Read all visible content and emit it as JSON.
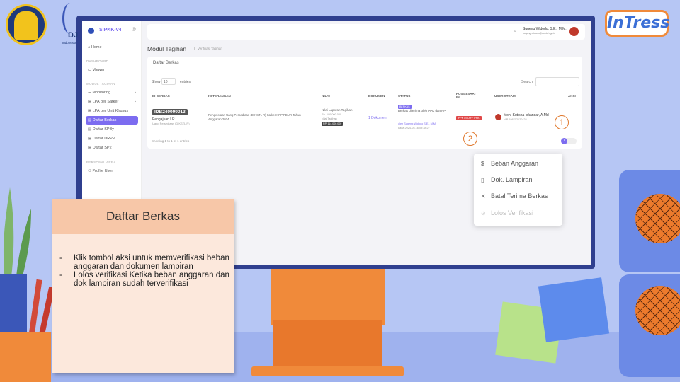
{
  "app": {
    "name": "SIPKK-v4"
  },
  "header": {
    "user_name": "Sugeng Widodo, S.E., M.M.",
    "user_email": "sugeng.widodo@contoh.go.id"
  },
  "sidebar": {
    "home": "Home",
    "section_dashboard": "DASHBOARD",
    "viewer": "Viewer",
    "section_modul": "MODUL TAGIHAN",
    "items": [
      {
        "label": "Monitoring"
      },
      {
        "label": "LPA per Satker"
      },
      {
        "label": "LPA per Unit Khusus"
      },
      {
        "label": "Daftar Berkas"
      },
      {
        "label": "Daftar SPBy"
      },
      {
        "label": "Daftar DRPP"
      },
      {
        "label": "Daftar SP2"
      }
    ],
    "section_personal": "PERSONAL AREA",
    "profile": "Profile User"
  },
  "page": {
    "title": "Modul Tagihan",
    "breadcrumb": "Verifikasi Tagihan"
  },
  "card": {
    "title": "Daftar Berkas",
    "show_label": "Show",
    "show_value": "10",
    "entries_label": "entries",
    "search_label": "Search:",
    "columns": [
      "ID BERKAS",
      "KETERANGAN",
      "NILAI",
      "DOKUMEN",
      "STATUS",
      "POSISI SAAT INI",
      "USER STKAM",
      "AKSI"
    ],
    "row": {
      "id": "IDB240000013",
      "id_sub1": "Pengajuan LP",
      "id_sub2": "Uang Persediaan (DIKSTL R)",
      "keterangan": "Pengelolaan Uang Persediaan (DIKSTL R) Satker KPP PBUR Tahun Anggaran 2024",
      "nilai1": "Nilai Laporan Tagihan",
      "nilai2": "Rp. 100.000.000",
      "nilai3": "Nilai Tagihan",
      "nilai_badge": "RP. 114.000.000",
      "dokumen": "1 Dokumen",
      "status_badge": "BERKAS",
      "status_text": "Berkas diterima oleh PPK dan PP",
      "status_by": "oleh Sugeng Widodo S.E., M.M.",
      "status_date": "pada 2024-05-16 09:38:27",
      "posisi_badge": "PPK / STAFF PPK",
      "user_name": "Moh. Sutisna Iskandar, A.Md",
      "user_sub": "NIP 198702120428"
    },
    "footer": "Showing 1 to 1 of 1 entries"
  },
  "action_menu": {
    "items": [
      {
        "icon": "dollar-icon",
        "label": "Beban Anggaran",
        "enabled": true
      },
      {
        "icon": "document-icon",
        "label": "Dok. Lampiran",
        "enabled": true
      },
      {
        "icon": "close-icon",
        "label": "Batal Terima Berkas",
        "enabled": true
      },
      {
        "icon": "block-icon",
        "label": "Lolos Verifikasi",
        "enabled": false
      }
    ]
  },
  "callouts": {
    "one": "1",
    "two": "2"
  },
  "info": {
    "title": "Daftar Berkas",
    "points": [
      "Klik tombol aksi untuk memverifikasi beban anggaran dan dokumen lampiran",
      "Lolos verifikasi Ketika beban anggaran dan dok lampiran sudah terverifikasi"
    ]
  },
  "brand": {
    "intress": "InTress",
    "dj": "DJ",
    "dj_sub": "Indonesia"
  },
  "colors": {
    "accent": "#7c6cf0",
    "orange": "#f08a3a",
    "danger": "#e04848",
    "background": "#b6c6f4"
  }
}
